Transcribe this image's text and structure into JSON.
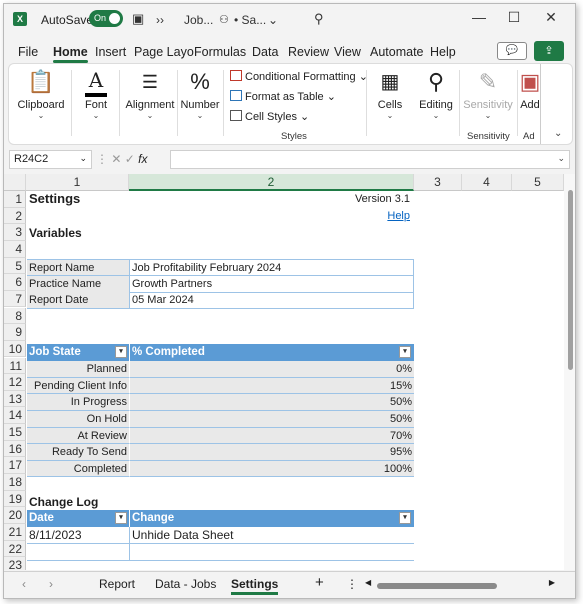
{
  "titlebar": {
    "app_icon": "X",
    "autosave_label": "AutoSave",
    "toggle_label": "On",
    "more": "››",
    "doc_name": "Job...",
    "saved_status": "• Sa...",
    "more_chevron": "⌄"
  },
  "tabs": [
    "File",
    "Home",
    "Insert",
    "Page Layo",
    "Formulas",
    "Data",
    "Review",
    "View",
    "Automate",
    "Help"
  ],
  "ribbon": {
    "clipboard": "Clipboard",
    "font": "Font",
    "alignment": "Alignment",
    "number": "Number",
    "conditional_formatting": "Conditional Formatting",
    "format_as_table": "Format as Table",
    "cell_styles": "Cell Styles",
    "styles_group": "Styles",
    "cells": "Cells",
    "editing": "Editing",
    "sensitivity": "Sensitivity",
    "sensitivity_group": "Sensitivity",
    "addins": "Add",
    "addins_group": "Ad"
  },
  "formula_bar": {
    "name_box": "R24C2",
    "fx": "fx",
    "value": ""
  },
  "columns": [
    "1",
    "2",
    "3",
    "4",
    "5"
  ],
  "rows": [
    "1",
    "2",
    "3",
    "4",
    "5",
    "6",
    "7",
    "8",
    "9",
    "10",
    "11",
    "12",
    "13",
    "14",
    "15",
    "16",
    "17",
    "18",
    "19",
    "20",
    "21",
    "22",
    "23"
  ],
  "sheet": {
    "title": "Settings",
    "version": "Version 3.1",
    "help_link": "Help",
    "variables_heading": "Variables",
    "variables": [
      {
        "label": "Report Name",
        "value": "Job Profitability February 2024"
      },
      {
        "label": "Practice Name",
        "value": "Growth Partners"
      },
      {
        "label": "Report Date",
        "value": "05 Mar 2024"
      }
    ],
    "job_table": {
      "headers": [
        "Job State",
        "% Completed"
      ],
      "rows": [
        {
          "state": "Planned",
          "pct": "0%"
        },
        {
          "state": "Pending Client Info",
          "pct": "15%"
        },
        {
          "state": "In Progress",
          "pct": "50%"
        },
        {
          "state": "On Hold",
          "pct": "50%"
        },
        {
          "state": "At Review",
          "pct": "70%"
        },
        {
          "state": "Ready To Send",
          "pct": "95%"
        },
        {
          "state": "Completed",
          "pct": "100%"
        }
      ]
    },
    "changelog_heading": "Change Log",
    "changelog": {
      "headers": [
        "Date",
        "Change"
      ],
      "rows": [
        {
          "date": "8/11/2023",
          "change": "Unhide Data Sheet"
        }
      ]
    }
  },
  "sheet_tabs": [
    "Report",
    "Data - Jobs",
    "Settings"
  ],
  "add_sheet": "+",
  "options": "⋮"
}
